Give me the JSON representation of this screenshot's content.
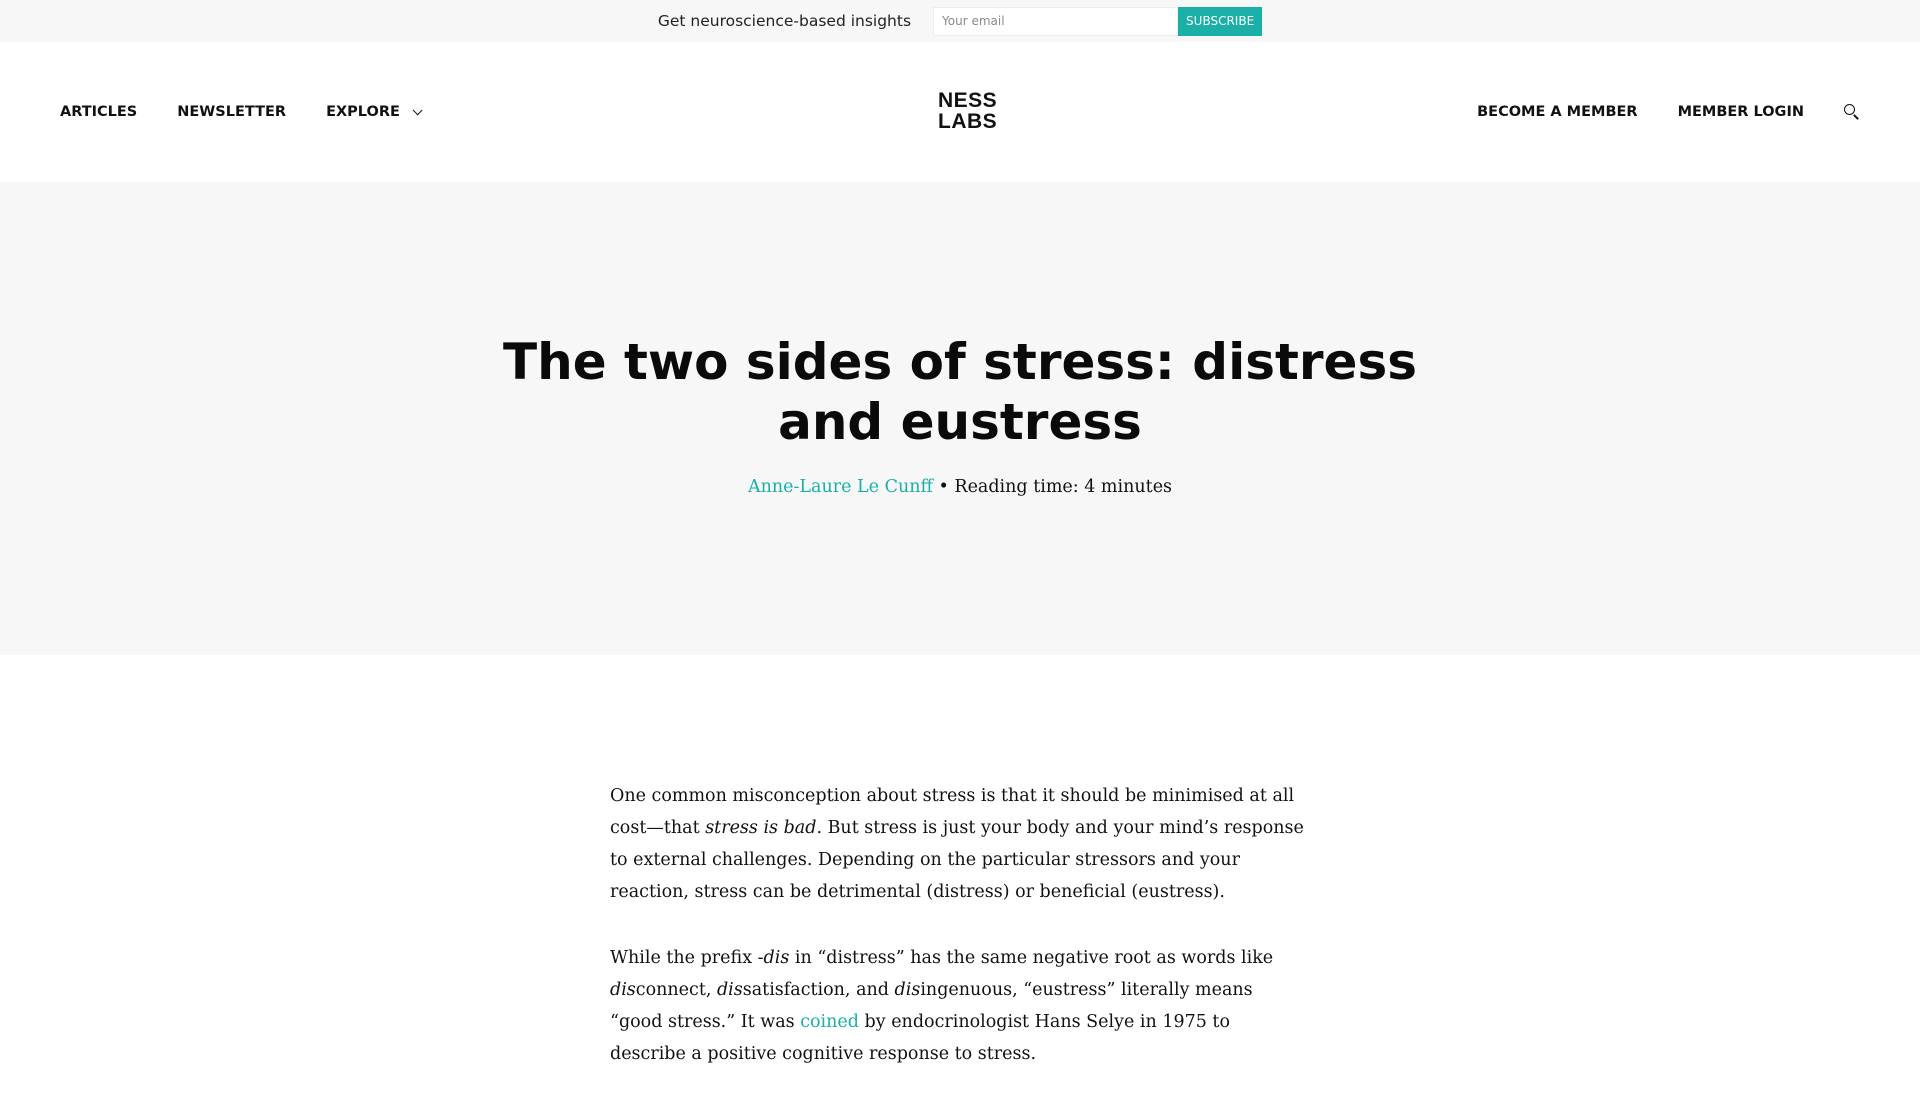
{
  "topbar": {
    "text": "Get neuroscience-based insights",
    "email_placeholder": "Your email",
    "subscribe_label": "SUBSCRIBE"
  },
  "nav": {
    "left": [
      {
        "label": "ARTICLES"
      },
      {
        "label": "NEWSLETTER"
      },
      {
        "label": "EXPLORE"
      }
    ],
    "right": [
      {
        "label": "BECOME A MEMBER"
      },
      {
        "label": "MEMBER LOGIN"
      }
    ]
  },
  "logo": {
    "line1": "NESS",
    "line2": "LABS"
  },
  "hero": {
    "title": "The two sides of stress: distress and eustress",
    "author": "Anne-Laure Le Cunff",
    "separator": " • ",
    "reading_time": "Reading time: 4 minutes"
  },
  "article": {
    "p1": {
      "a": "One common misconception about stress is that it should be minimised at all cost—that ",
      "em": "stress is bad",
      "b": ". But stress is just your body and your mind’s response to external challenges. Depending on the particular stressors and your reaction, stress can be detrimental (distress) or beneficial (eustress)."
    },
    "p2": {
      "a": "While the prefix -",
      "em1": "dis",
      "b": " in “distress” has the same negative root as words like ",
      "em2": "dis",
      "c": "connect, ",
      "em3": "dis",
      "d": "satisfaction, and ",
      "em4": "dis",
      "e": "ingenuous, “eustress” literally means “good stress.” It was ",
      "link": "coined",
      "f": " by endocrinologist Hans Selye in 1975 to describe a positive cognitive response to stress."
    }
  },
  "colors": {
    "accent": "#1ab0a8",
    "hero_bg": "#f7f7f7",
    "text": "#111111"
  },
  "icons": {
    "search": "search-icon",
    "explore_chevron": "chevron-down-icon"
  }
}
